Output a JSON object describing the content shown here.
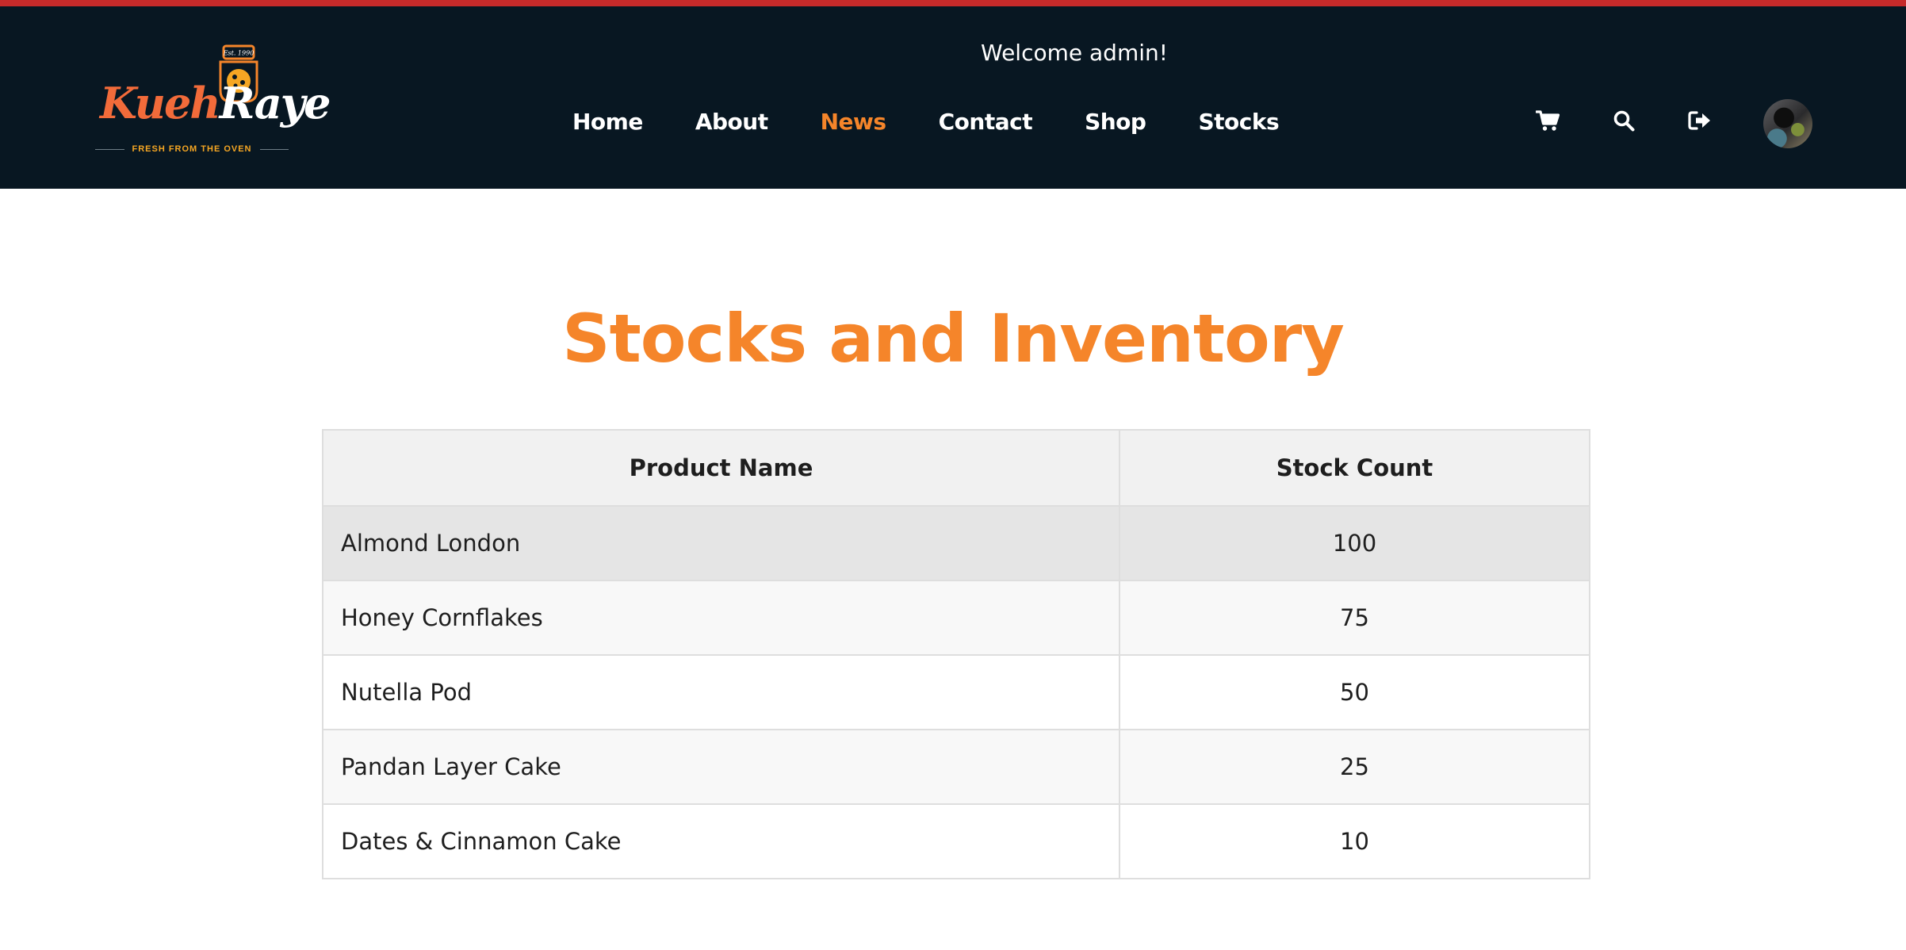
{
  "brand": {
    "logo_primary": "Kueh",
    "logo_secondary": "Raye",
    "tagline": "FRESH FROM THE OVEN",
    "badge": "Est. 1990"
  },
  "header": {
    "welcome": "Welcome admin!",
    "nav": [
      {
        "label": "Home",
        "active": false
      },
      {
        "label": "About",
        "active": false
      },
      {
        "label": "News",
        "active": true
      },
      {
        "label": "Contact",
        "active": false
      },
      {
        "label": "Shop",
        "active": false
      },
      {
        "label": "Stocks",
        "active": false
      }
    ],
    "icons": [
      "cart-icon",
      "search-icon",
      "logout-icon",
      "user-avatar"
    ]
  },
  "page": {
    "title": "Stocks and Inventory"
  },
  "table": {
    "headers": [
      "Product Name",
      "Stock Count"
    ],
    "rows": [
      {
        "name": "Almond London",
        "count": "100"
      },
      {
        "name": "Honey Cornflakes",
        "count": "75"
      },
      {
        "name": "Nutella Pod",
        "count": "50"
      },
      {
        "name": "Pandan Layer Cake",
        "count": "25"
      },
      {
        "name": "Dates & Cinnamon Cake",
        "count": "10"
      }
    ]
  },
  "colors": {
    "accent": "#f5852a",
    "header_bg": "#081722",
    "top_stripe": "#c62a2a"
  }
}
